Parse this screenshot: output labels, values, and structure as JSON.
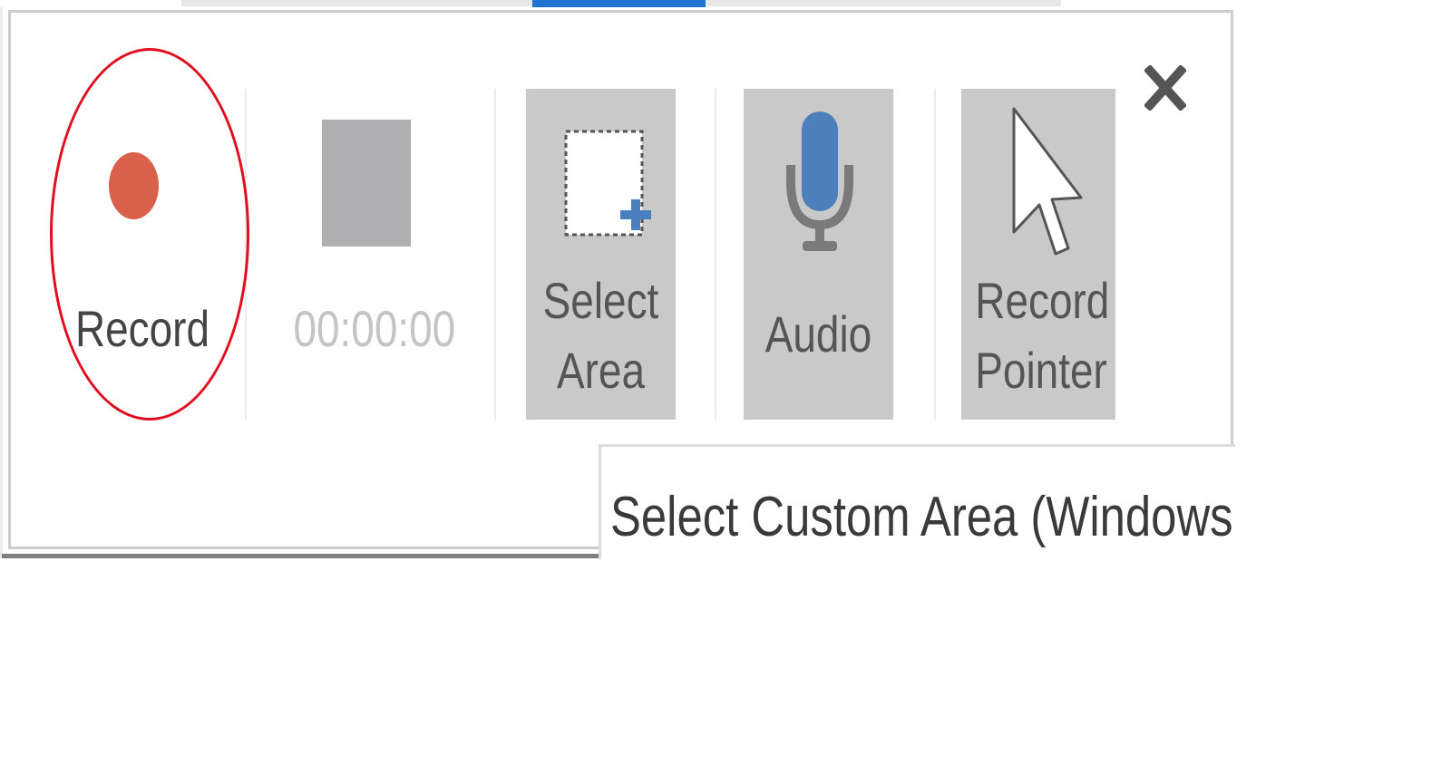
{
  "toolbar": {
    "record_label": "Record",
    "timer": "00:00:00",
    "select_area_label_line1": "Select",
    "select_area_label_line2": "Area",
    "audio_label": "Audio",
    "record_pointer_label_line1": "Record",
    "record_pointer_label_line2": "Pointer"
  },
  "tooltip": {
    "text": "Select Custom Area (Windows lo"
  },
  "icons": {
    "record": "record-dot-icon",
    "stop": "stop-square-icon",
    "select_area": "dashed-rectangle-plus-icon",
    "audio": "microphone-icon",
    "pointer": "mouse-pointer-icon",
    "close": "close-x-icon"
  },
  "colors": {
    "record_dot": "#d9604a",
    "highlight_oval": "#e10f1d",
    "active_indicator": "#1e74d2",
    "tool_button_bg": "#c9c9c9",
    "accent_blue": "#4a7fbf"
  }
}
